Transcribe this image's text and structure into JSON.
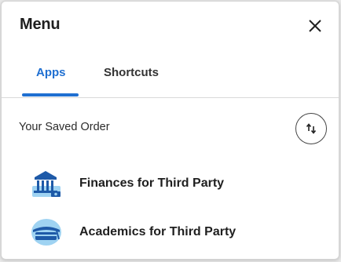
{
  "menu": {
    "title": "Menu",
    "close_icon": "close-icon"
  },
  "tabs": [
    {
      "label": "Apps",
      "active": true
    },
    {
      "label": "Shortcuts",
      "active": false
    }
  ],
  "saved_order": {
    "label": "Your Saved Order",
    "sort_icon": "sort-arrows-icon"
  },
  "apps": [
    {
      "label": "Finances for Third Party",
      "icon": "bank-icon"
    },
    {
      "label": "Academics for Third Party",
      "icon": "graduation-cap-icon"
    }
  ],
  "colors": {
    "accent": "#1f6fd1",
    "icon_light_blue": "#9fd3f2",
    "icon_dark_blue": "#1e5aa8"
  }
}
